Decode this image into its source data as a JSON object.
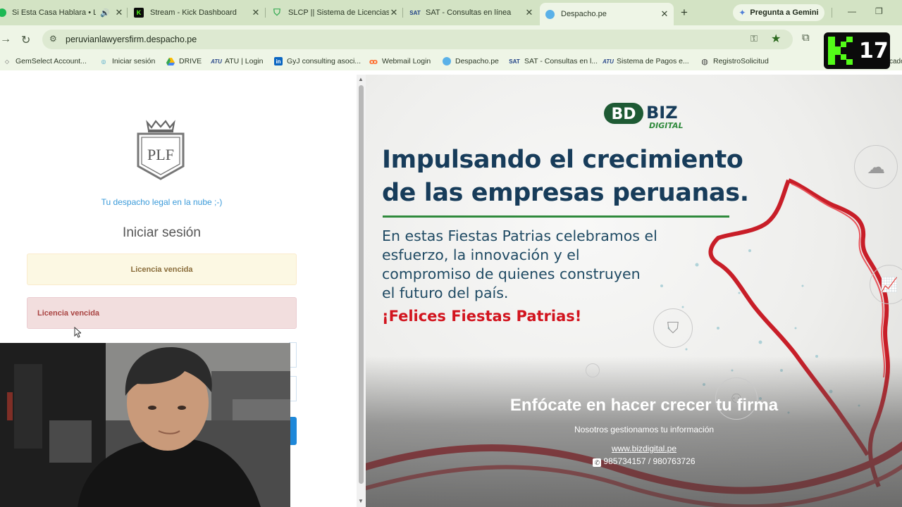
{
  "tabs": [
    {
      "title": "Si Esta Casa Hablara • La",
      "active": false,
      "icon": "spotify-icon",
      "audio": true
    },
    {
      "title": "Stream - Kick Dashboard",
      "active": false,
      "icon": "kick-icon"
    },
    {
      "title": "SLCP || Sistema de Licencias",
      "active": false,
      "icon": "shield-check-icon"
    },
    {
      "title": "SAT - Consultas en línea",
      "active": false,
      "icon": "sat-icon",
      "icon_text": "SAT"
    },
    {
      "title": "Despacho.pe",
      "active": true,
      "icon": "cloud-icon"
    }
  ],
  "gemini_button": "Pregunta a Gemini",
  "address_bar": {
    "url": "peruvianlawyersfirm.despacho.pe"
  },
  "bookmarks": [
    {
      "label": "GemSelect Account...",
      "icon": "gem-icon"
    },
    {
      "label": "Iniciar sesión",
      "icon": "login-icon"
    },
    {
      "label": "DRIVE",
      "icon": "drive-icon"
    },
    {
      "label": "ATU | Login",
      "icon": "atu-icon"
    },
    {
      "label": "GyJ consulting asoci...",
      "icon": "linkedin-icon",
      "icon_text": "in"
    },
    {
      "label": "Webmail Login",
      "icon": "cpanel-icon"
    },
    {
      "label": "Despacho.pe",
      "icon": "cloud-icon"
    },
    {
      "label": "SAT - Consultas en l...",
      "icon": "sat-icon",
      "icon_text": "SAT"
    },
    {
      "label": "Sistema de Pagos e...",
      "icon": "atu-icon"
    },
    {
      "label": "RegistroSolicitud",
      "icon": "globe-icon"
    }
  ],
  "bookmarks_overflow": "cado",
  "stream_badge": {
    "count": "17"
  },
  "login": {
    "logo_text": "PLF",
    "tagline": "Tu despacho legal en la nube ;-)",
    "heading": "Iniciar sesión",
    "alert_warning": "Licencia vencida",
    "alert_danger": "Licencia vencida"
  },
  "promo": {
    "brand": "BIZ",
    "brand_sub": "DIGITAL",
    "headline_1": "Impulsando el crecimiento",
    "headline_2": "de las empresas peruanas.",
    "body_lines": [
      "En estas Fiestas Patrias celebramos el",
      "esfuerzo, la innovación y el",
      "compromiso de quienes construyen",
      "el futuro del país."
    ],
    "celebration": "¡Felices Fiestas Patrias!",
    "cta_title": "Enfócate en hacer crecer tu firma",
    "cta_subtitle": "Nosotros gestionamos tu información",
    "website": "www.bizdigital.pe",
    "phones": "985734157 / 980763726"
  },
  "colors": {
    "headline": "#173c5a",
    "celebration": "#d2141e",
    "tagline": "#3a9ad9",
    "warning_bg": "#fcf8e3",
    "danger_bg": "#f2dede",
    "browser_frame": "#d3e3c4"
  }
}
